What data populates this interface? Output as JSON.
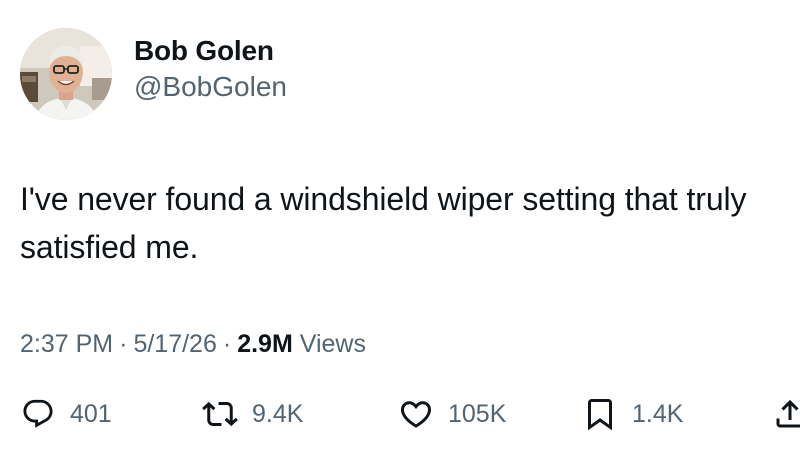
{
  "author": {
    "display_name": "Bob Golen",
    "handle": "@BobGolen",
    "avatar_icon": "profile-photo"
  },
  "tweet": {
    "text": "I've never found a windshield wiper setting that truly satisfied me."
  },
  "meta": {
    "time": "2:37 PM",
    "separator": "·",
    "date": "5/17/26",
    "views_count": "2.9M",
    "views_label": "Views"
  },
  "actions": {
    "reply": {
      "icon": "reply-icon",
      "count": "401"
    },
    "retweet": {
      "icon": "retweet-icon",
      "count": "9.4K"
    },
    "like": {
      "icon": "heart-icon",
      "count": "105K"
    },
    "bookmark": {
      "icon": "bookmark-icon",
      "count": "1.4K"
    },
    "share": {
      "icon": "share-icon"
    }
  },
  "colors": {
    "text": "#0f1419",
    "secondary": "#536471",
    "background": "#ffffff"
  }
}
